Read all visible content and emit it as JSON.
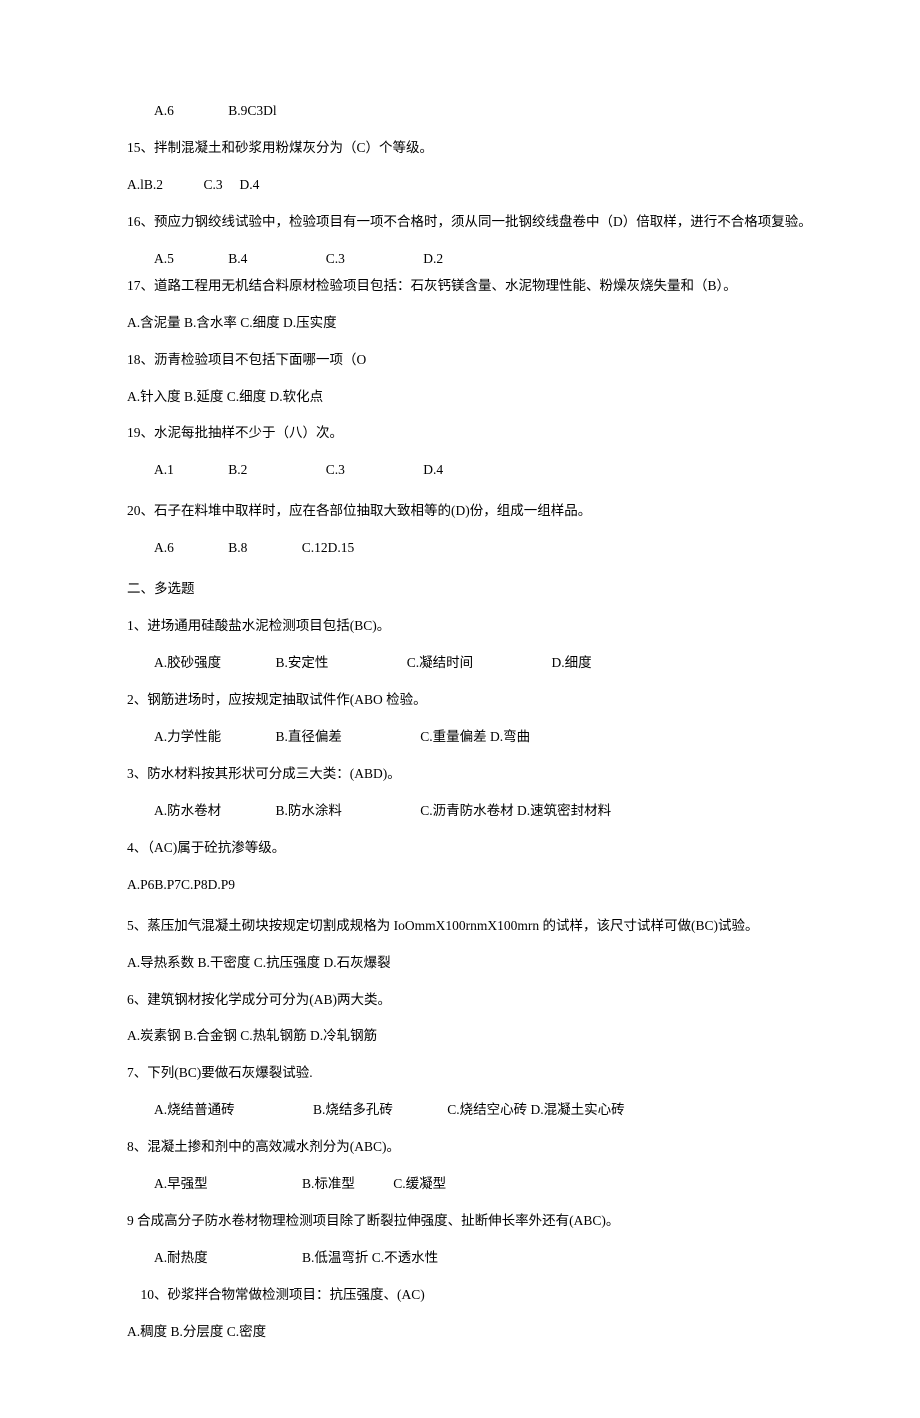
{
  "q14_opts": {
    "a": "A.6",
    "b": "B.9C3Dl"
  },
  "q15": {
    "text": "15、拌制混凝土和砂浆用粉煤灰分为（C）个等级。",
    "opts": "A.lB.2   C.3  D.4"
  },
  "q16": {
    "text": "16、预应力钢绞线试验中，检验项目有一项不合格时，须从同一批钢绞线盘卷中（D）倍取样，进行不合格项复验。",
    "a": "A.5",
    "b": "B.4",
    "c": "C.3",
    "d": "D.2"
  },
  "q17": {
    "text": "17、道路工程用无机结合料原材检验项目包括：石灰钙镁含量、水泥物理性能、粉燥灰烧失量和（B）。",
    "opts": "A.含泥量 B.含水率 C.细度 D.压实度"
  },
  "q18": {
    "text": "18、沥青检验项目不包括下面哪一项（O",
    "opts": "A.针入度 B.延度 C.细度 D.软化点"
  },
  "q19": {
    "text": "19、水泥每批抽样不少于（八）次。",
    "a": "A.1",
    "b": "B.2",
    "c": "C.3",
    "d": "D.4"
  },
  "q20": {
    "text": "20、石子在料堆中取样时，应在各部位抽取大致相等的(D)份，组成一组样品。",
    "a": "A.6",
    "b": "B.8",
    "c": "C.12D.15"
  },
  "section2": "二、多选题",
  "m1": {
    "text": "1、进场通用硅酸盐水泥检测项目包括(BC)。",
    "a": "A.胶砂强度",
    "b": "B.安定性",
    "c": "C.凝结时间",
    "d": "D.细度"
  },
  "m2": {
    "text": "2、钢筋进场时，应按规定抽取试件作(ABO 检验。",
    "a": "A.力学性能",
    "b": "B.直径偏差",
    "c": "C.重量偏差 D.弯曲"
  },
  "m3": {
    "text": "3、防水材料按其形状可分成三大类：(ABD)。",
    "a": "A.防水卷材",
    "b": "B.防水涂料",
    "c": "C.沥青防水卷材 D.速筑密封材料"
  },
  "m4": {
    "text": "4、（AC)属于砼抗渗等级。",
    "opts": "A.P6B.P7C.P8D.P9"
  },
  "m5": {
    "text": "5、蒸压加气混凝土砌块按规定切割成规格为 IoOmmX100rnmX100mrn 的试样，该尺寸试样可做(BC)试验。",
    "opts": " A.导热系数 B.干密度 C.抗压强度 D.石灰爆裂"
  },
  "m6": {
    "text": "6、建筑钢材按化学成分可分为(AB)两大类。",
    "opts": " A.炭素钢 B.合金钢 C.热轧钢筋 D.冷轧钢筋"
  },
  "m7": {
    "text": "7、下列(BC)要做石灰爆裂试验.",
    "a": "A.烧结普通砖",
    "b": "B.烧结多孔砖",
    "c": "C.烧结空心砖 D.混凝土实心砖"
  },
  "m8": {
    "text": "8、混凝土掺和剂中的高效减水剂分为(ABC)。",
    "a": "A.早强型",
    "b": "B.标准型",
    "c": "C.缓凝型"
  },
  "m9": {
    "text": "9 合成高分子防水卷材物理检测项目除了断裂拉伸强度、扯断伸长率外还有(ABC)。",
    "a": "A.耐热度",
    "b": "B.低温弯折 C.不透水性"
  },
  "m10": {
    "text": "10、砂浆拌合物常做检测项目：抗压强度、(AC)",
    "opts": "A.稠度 B.分层度 C.密度"
  }
}
